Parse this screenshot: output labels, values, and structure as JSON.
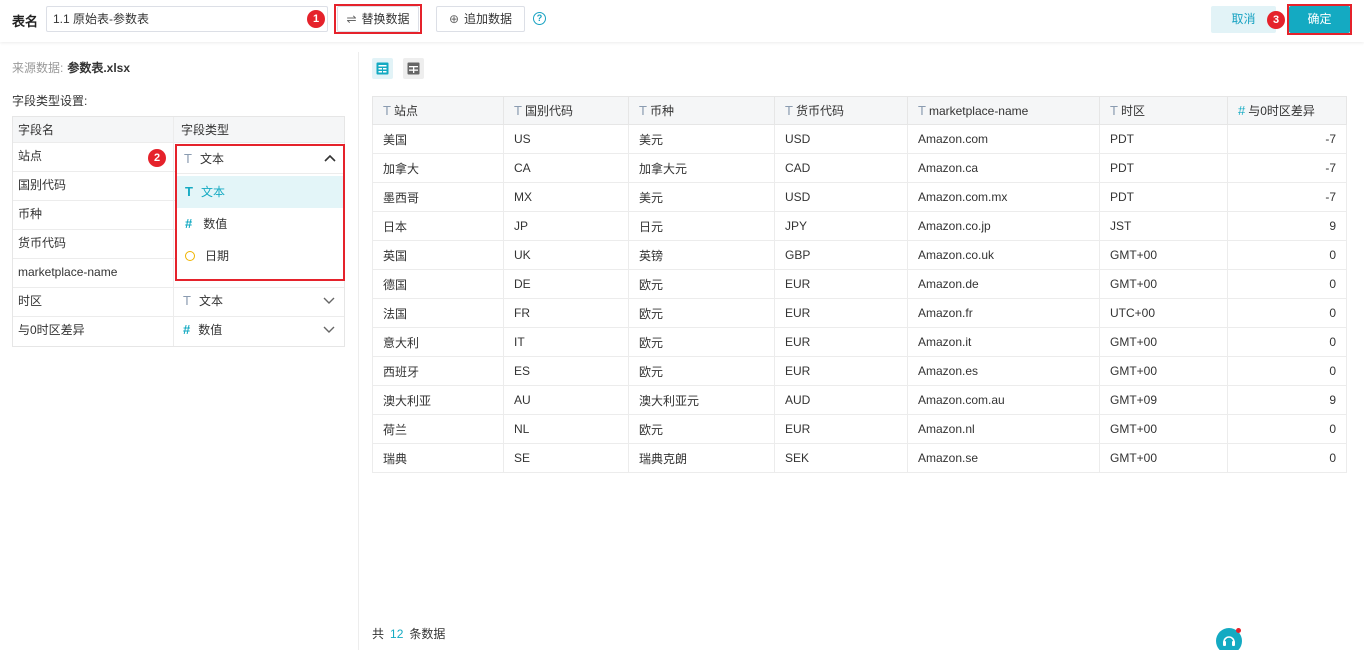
{
  "header": {
    "table_label": "表名",
    "table_name": "1.1 原始表-参数表",
    "replace_label": "替换数据",
    "append_label": "追加数据",
    "help_symbol": "?",
    "cancel_label": "取消",
    "ok_label": "确定",
    "badges": [
      "1",
      "3"
    ]
  },
  "left": {
    "source_label": "来源数据:",
    "source_file": "参数表.xlsx",
    "fieldset_title": "字段类型设置:",
    "col_name": "字段名",
    "col_type": "字段类型",
    "badge": "2",
    "fields": [
      {
        "name": "站点",
        "type": "文本",
        "kind": "text"
      },
      {
        "name": "国别代码"
      },
      {
        "name": "币种"
      },
      {
        "name": "货币代码"
      },
      {
        "name": "marketplace-name"
      },
      {
        "name": "时区",
        "type": "文本",
        "kind": "text"
      },
      {
        "name": "与0时区差异",
        "type": "数值",
        "kind": "number"
      }
    ],
    "dropdown": {
      "current": "文本",
      "options": [
        {
          "label": "文本",
          "kind": "text",
          "selected": true
        },
        {
          "label": "数值",
          "kind": "number"
        },
        {
          "label": "日期",
          "kind": "date"
        }
      ]
    }
  },
  "icons": {
    "text": "T",
    "number": "#",
    "replace": "⇌",
    "append": "⊕"
  },
  "colors": {
    "accent": "#14aac2",
    "highlight": "#e5222b",
    "date_icon": "#f0b400"
  },
  "table": {
    "columns": [
      {
        "label": "站点",
        "kind": "text"
      },
      {
        "label": "国别代码",
        "kind": "text"
      },
      {
        "label": "币种",
        "kind": "text"
      },
      {
        "label": "货币代码",
        "kind": "text"
      },
      {
        "label": "marketplace-name",
        "kind": "text"
      },
      {
        "label": "时区",
        "kind": "text"
      },
      {
        "label": "与0时区差异",
        "kind": "number"
      }
    ],
    "rows": [
      [
        "美国",
        "US",
        "美元",
        "USD",
        "Amazon.com",
        "PDT",
        "-7"
      ],
      [
        "加拿大",
        "CA",
        "加拿大元",
        "CAD",
        "Amazon.ca",
        "PDT",
        "-7"
      ],
      [
        "墨西哥",
        "MX",
        "美元",
        "USD",
        "Amazon.com.mx",
        "PDT",
        "-7"
      ],
      [
        "日本",
        "JP",
        "日元",
        "JPY",
        "Amazon.co.jp",
        "JST",
        "9"
      ],
      [
        "英国",
        "UK",
        "英镑",
        "GBP",
        "Amazon.co.uk",
        "GMT+00",
        "0"
      ],
      [
        "德国",
        "DE",
        "欧元",
        "EUR",
        "Amazon.de",
        "GMT+00",
        "0"
      ],
      [
        "法国",
        "FR",
        "欧元",
        "EUR",
        "Amazon.fr",
        "UTC+00",
        "0"
      ],
      [
        "意大利",
        "IT",
        "欧元",
        "EUR",
        "Amazon.it",
        "GMT+00",
        "0"
      ],
      [
        "西班牙",
        "ES",
        "欧元",
        "EUR",
        "Amazon.es",
        "GMT+00",
        "0"
      ],
      [
        "澳大利亚",
        "AU",
        "澳大利亚元",
        "AUD",
        "Amazon.com.au",
        "GMT+09",
        "9"
      ],
      [
        "荷兰",
        "NL",
        "欧元",
        "EUR",
        "Amazon.nl",
        "GMT+00",
        "0"
      ],
      [
        "瑞典",
        "SE",
        "瑞典克朗",
        "SEK",
        "Amazon.se",
        "GMT+00",
        "0"
      ]
    ]
  },
  "footer": {
    "prefix": "共",
    "count": "12",
    "suffix": "条数据"
  }
}
